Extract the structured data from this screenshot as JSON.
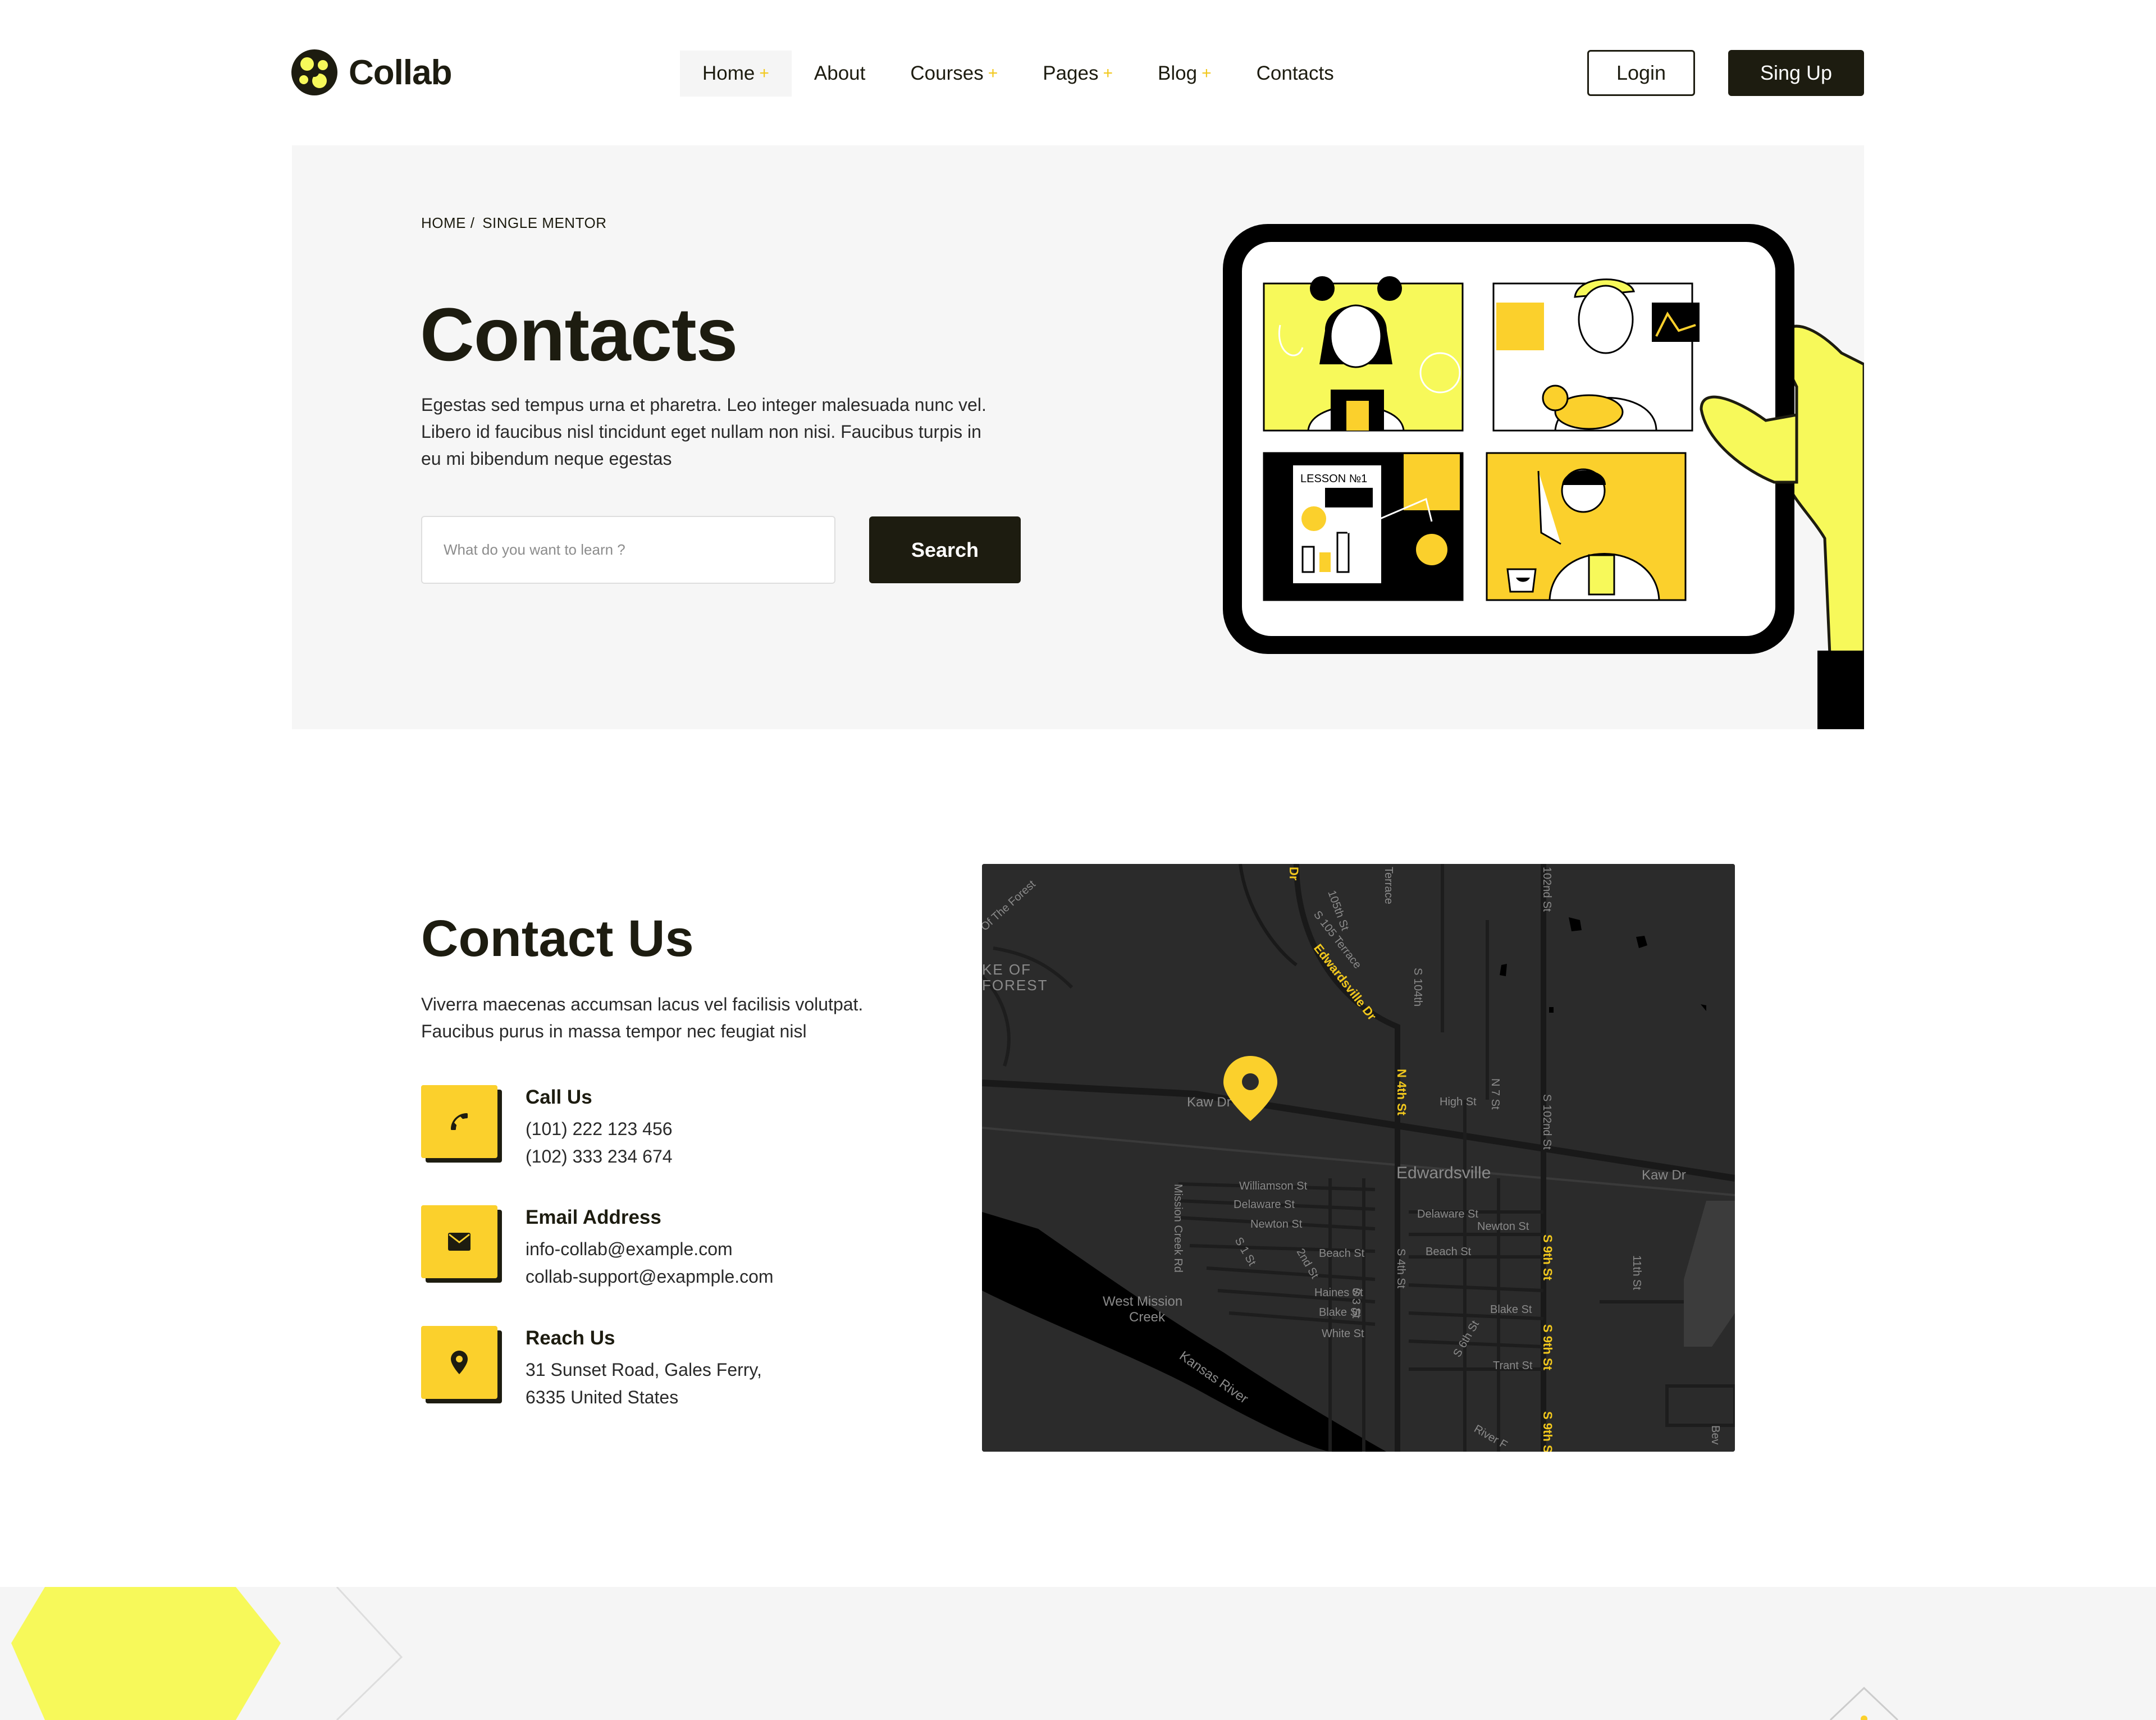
{
  "brand": {
    "name": "Collab"
  },
  "nav": {
    "items": [
      {
        "label": "Home",
        "plus": "+"
      },
      {
        "label": "About",
        "plus": ""
      },
      {
        "label": "Courses",
        "plus": "+"
      },
      {
        "label": "Pages",
        "plus": "+"
      },
      {
        "label": "Blog",
        "plus": "+"
      },
      {
        "label": "Contacts",
        "plus": ""
      }
    ],
    "login_label": "Login",
    "signup_label": "Sing Up"
  },
  "hero": {
    "breadcrumb": {
      "home": "HOME",
      "separator": "/",
      "current": "SINGLE MENTOR"
    },
    "title": "Contacts",
    "text": "Egestas sed tempus urna et pharetra. Leo integer malesuada nunc vel. Libero id faucibus nisl tincidunt eget nullam non nisi. Faucibus turpis in eu mi bibendum neque egestas",
    "search_placeholder": "What do you want to learn ?",
    "search_label": "Search",
    "illustration": {
      "lesson_label": "LESSON №1"
    }
  },
  "contact": {
    "title": "Contact Us",
    "text": "Viverra maecenas accumsan lacus vel facilisis volutpat. Faucibus purus in massa tempor nec feugiat nisl",
    "call": {
      "label": "Call Us",
      "lines": [
        "(101) 222 123 456",
        "(102) 333 234 674"
      ]
    },
    "email": {
      "label": "Email Address",
      "lines": [
        "info-collab@example.com",
        "collab-support@exapmple.com"
      ]
    },
    "reach": {
      "label": "Reach Us",
      "lines": [
        "31 Sunset Road, Gales Ferry,",
        "6335  United States"
      ]
    }
  },
  "map": {
    "labels": {
      "edwardsville": "Edwardsville",
      "kaw_dr_left": "Kaw Dr",
      "kaw_dr_right": "Kaw Dr",
      "edwardsville_dr": "Edwardsville Dr",
      "n4th": "N 4th St",
      "high": "High St",
      "n7th": "N 7 St",
      "s102": "S 102nd St",
      "st102": "102nd St",
      "s105": "S 105 Terrace",
      "st105": "105th St",
      "s104": "S 104th",
      "terrace": "Terrace",
      "williamson": "Williamson St",
      "delaware_l": "Delaware St",
      "newton_l": "Newton St",
      "beach_l": "Beach St",
      "haines": "Haines St",
      "blake_l": "Blake St",
      "white": "White St",
      "delaware_r": "Delaware St",
      "newton_r": "Newton St",
      "beach_r": "Beach St",
      "blake_r": "Blake St",
      "trant": "Trant St",
      "s9th_a": "S 9th St",
      "s9th_b": "S 9th St",
      "s9th_c": "S 9th St",
      "th11": "11th St",
      "s1st": "S 1 St",
      "s2nd": "2nd St",
      "s3": "S 3 St",
      "s4th": "S 4th St",
      "s6th": "S 6th St",
      "mission_rd": "Mission Creek Rd",
      "wm1": "West Mission",
      "wm2": "Creek",
      "kansas": "Kansas River",
      "river": "River F",
      "forest1": "KE OF",
      "forest2": "FOREST",
      "forest_road": "Of The Forest",
      "dr_top": "Dr",
      "bev": "Bev"
    }
  },
  "colors": {
    "dark": "#1d1c10",
    "accent_yellow": "#fbd02c",
    "light_yellow": "#f7f95a",
    "map_bg": "#2b2b2b"
  },
  "icons": {
    "call": "phone-icon",
    "email": "envelope-icon",
    "reach": "map-pin-icon",
    "map_marker": "map-marker-icon",
    "logo": "logo-mark-icon"
  }
}
